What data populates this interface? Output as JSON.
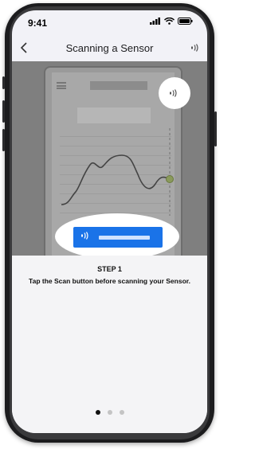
{
  "status_bar": {
    "time": "9:41",
    "icons": [
      "signal-icon",
      "wifi-icon",
      "battery-icon"
    ]
  },
  "nav": {
    "back_icon": "chevron-left-icon",
    "title": "Scanning a Sensor",
    "scan_icon": "nfc-scan-icon"
  },
  "illustration": {
    "description_icons": [
      "menu-icon",
      "nfc-scan-icon",
      "glucose-graph"
    ]
  },
  "content": {
    "step_label": "STEP 1",
    "instruction": "Tap the Scan button before scanning your Sensor."
  },
  "pager": {
    "total": 3,
    "current": 1
  },
  "colors": {
    "scan_button": "#1a73e8",
    "illustration_bg": "#7f7f7f",
    "screen_bg": "#f2f2f7"
  }
}
